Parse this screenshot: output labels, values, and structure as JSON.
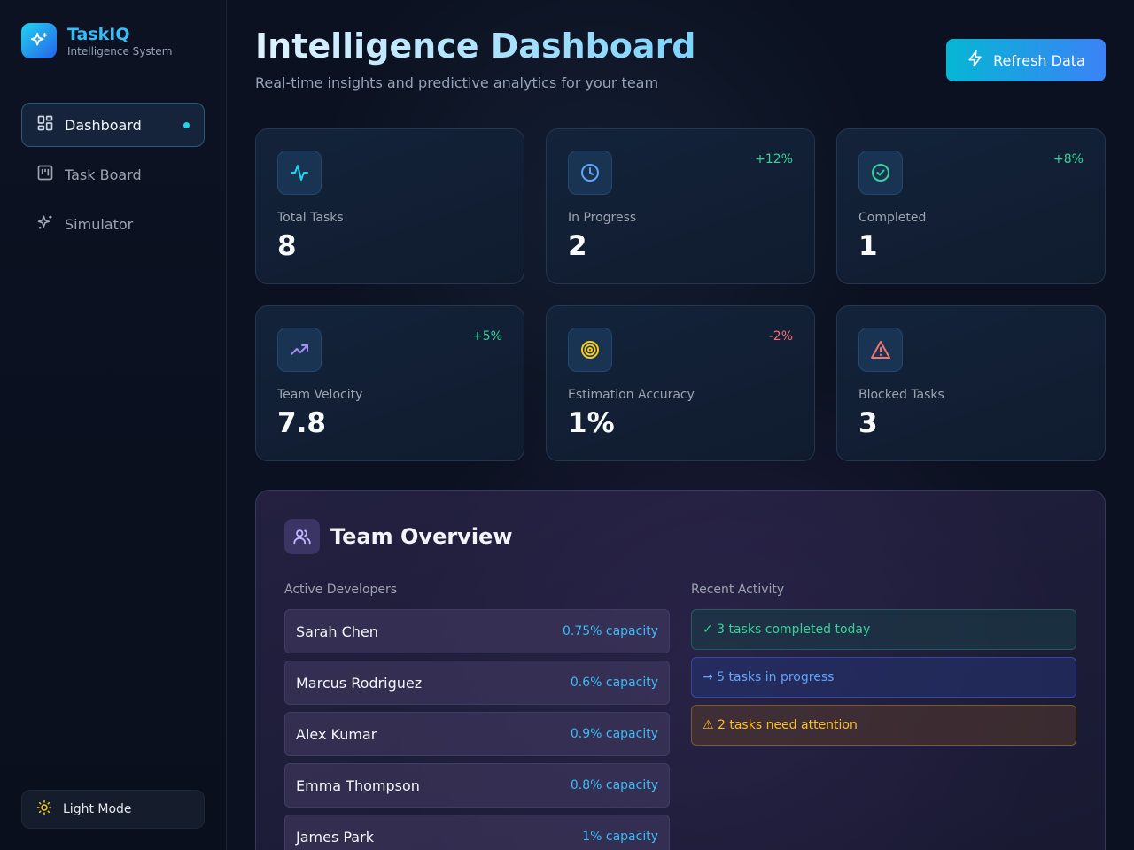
{
  "brand": {
    "name": "TaskIQ",
    "subtitle": "Intelligence System"
  },
  "nav": {
    "items": [
      {
        "label": "Dashboard",
        "icon": "dashboard-icon",
        "active": true
      },
      {
        "label": "Task Board",
        "icon": "kanban-icon",
        "active": false
      },
      {
        "label": "Simulator",
        "icon": "sparkles-icon",
        "active": false
      }
    ],
    "theme_toggle": "Light Mode"
  },
  "header": {
    "title": "Intelligence Dashboard",
    "subtitle": "Real-time insights and predictive analytics for your team",
    "refresh_label": "Refresh Data"
  },
  "stats": [
    {
      "label": "Total Tasks",
      "value": "8",
      "change": "",
      "icon": "activity-icon",
      "color": "#22d3ee"
    },
    {
      "label": "In Progress",
      "value": "2",
      "change": "+12%",
      "icon": "clock-icon",
      "color": "#60a5fa"
    },
    {
      "label": "Completed",
      "value": "1",
      "change": "+8%",
      "icon": "check-circle-icon",
      "color": "#34d399"
    },
    {
      "label": "Team Velocity",
      "value": "7.8",
      "change": "+5%",
      "icon": "trending-up-icon",
      "color": "#a78bfa"
    },
    {
      "label": "Estimation Accuracy",
      "value": "1%",
      "change": "-2%",
      "icon": "target-icon",
      "color": "#facc15"
    },
    {
      "label": "Blocked Tasks",
      "value": "3",
      "change": "",
      "icon": "alert-triangle-icon",
      "color": "#f87171"
    }
  ],
  "team": {
    "title": "Team Overview",
    "developers_label": "Active Developers",
    "developers": [
      {
        "name": "Sarah Chen",
        "capacity": "0.75% capacity"
      },
      {
        "name": "Marcus Rodriguez",
        "capacity": "0.6% capacity"
      },
      {
        "name": "Alex Kumar",
        "capacity": "0.9% capacity"
      },
      {
        "name": "Emma Thompson",
        "capacity": "0.8% capacity"
      },
      {
        "name": "James Park",
        "capacity": "1% capacity"
      }
    ],
    "activity_label": "Recent Activity",
    "activity": [
      {
        "text": "✓ 3 tasks completed today",
        "tone": "green"
      },
      {
        "text": "→ 5 tasks in progress",
        "tone": "blue"
      },
      {
        "text": "⚠ 2 tasks need attention",
        "tone": "amber"
      }
    ]
  }
}
